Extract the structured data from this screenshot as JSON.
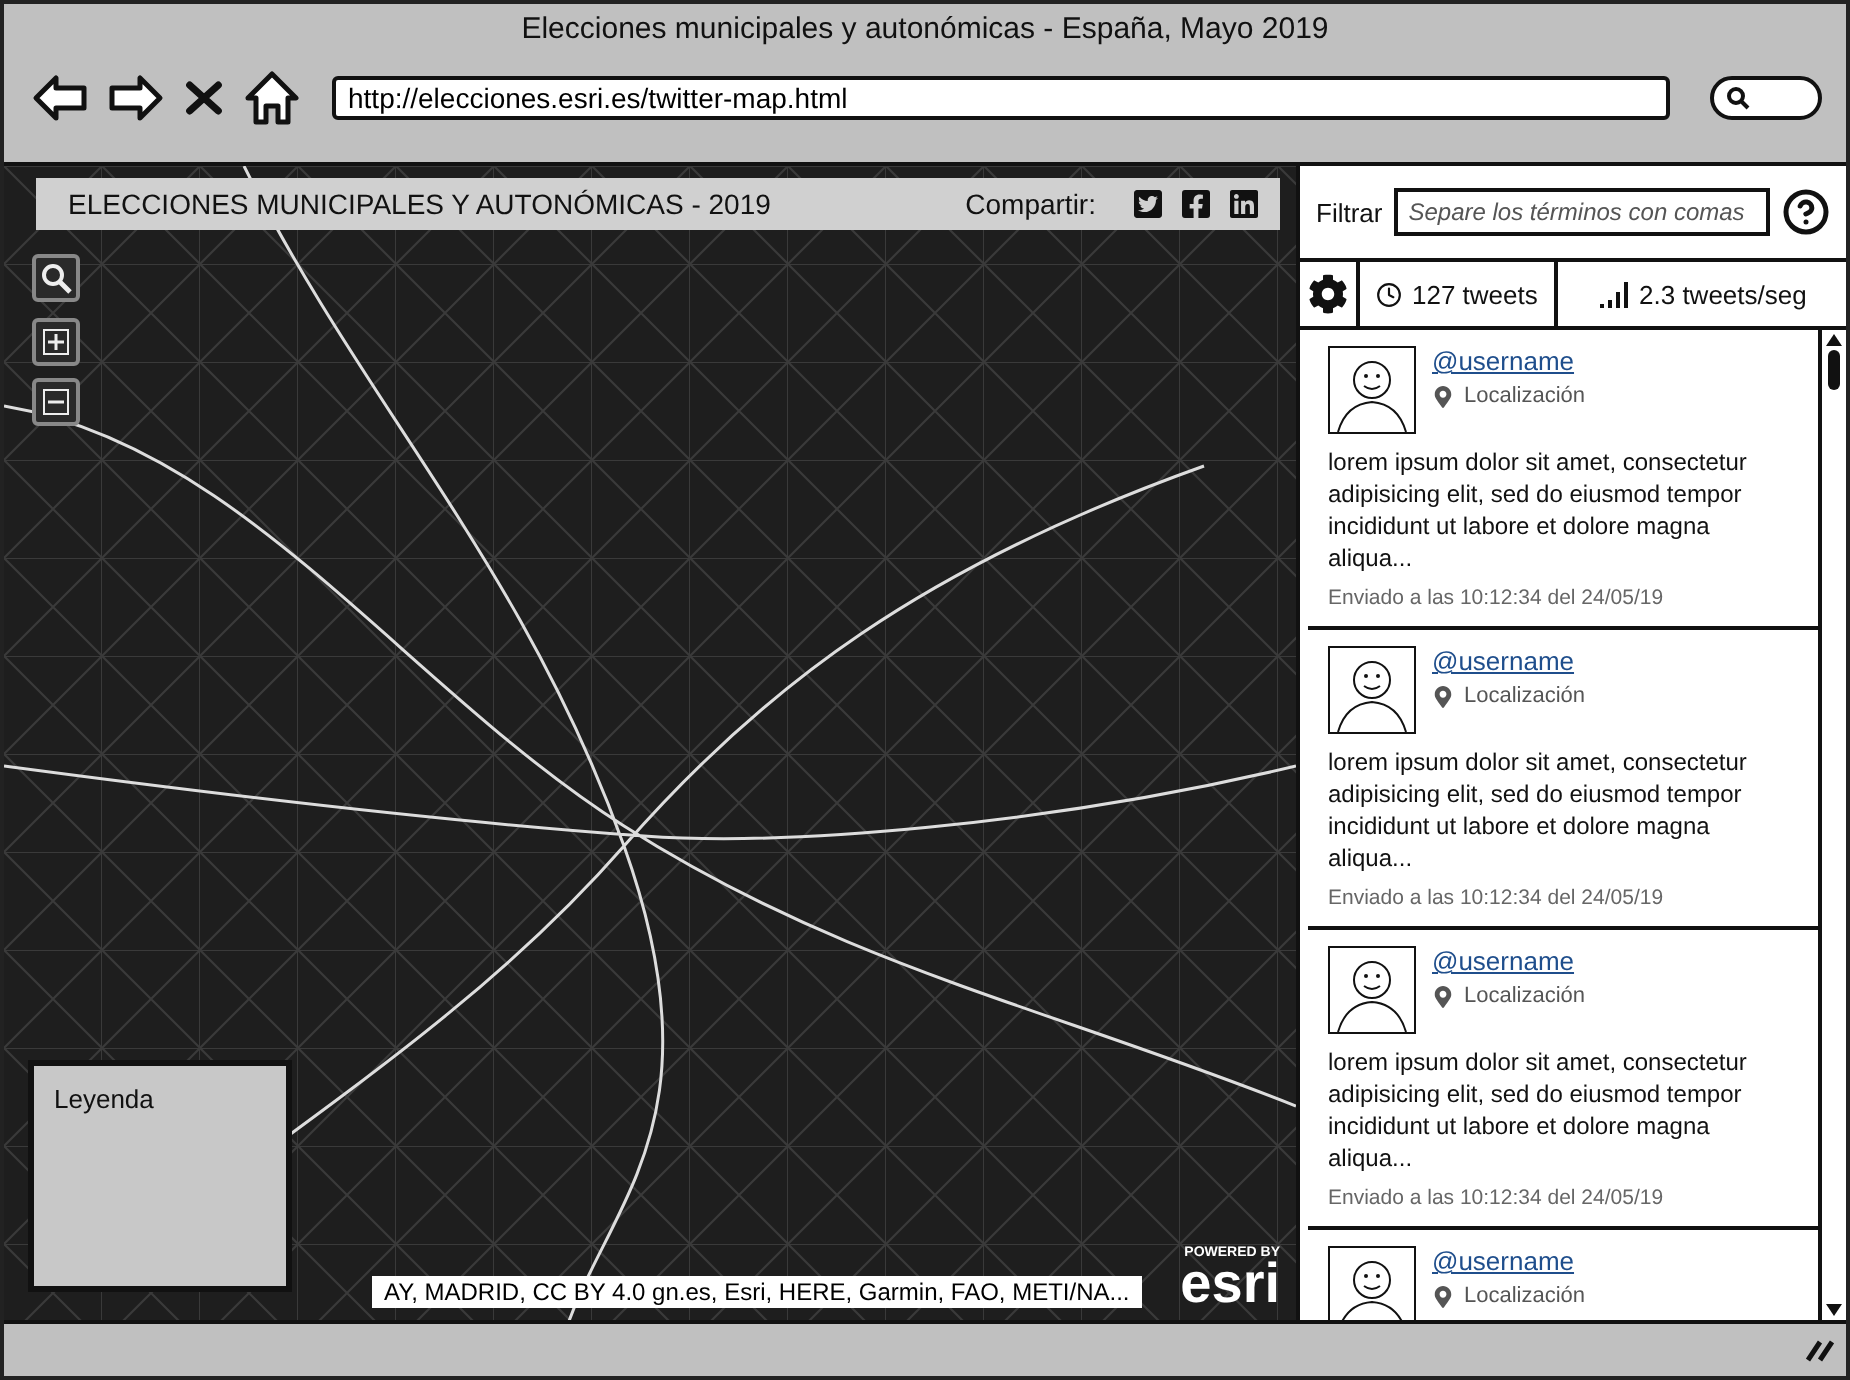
{
  "window": {
    "title": "Elecciones municipales y autonómicas - España, Mayo 2019"
  },
  "address_bar": {
    "value": "http://elecciones.esri.es/twitter-map.html"
  },
  "map": {
    "title": "ELECCIONES MUNICIPALES Y AUTONÓMICAS - 2019",
    "share_label": "Compartir:",
    "legend_title": "Leyenda",
    "attribution": "AY, MADRID, CC BY 4.0  gn.es, Esri, HERE, Garmin, FAO, METI/NA...",
    "logo": {
      "caption": "POWERED BY",
      "name": "esri"
    }
  },
  "sidebar": {
    "filter_label": "Filtrar",
    "filter_placeholder": "Separe los términos con comas",
    "tweet_count": "127 tweets",
    "rate": "2.3 tweets/seg",
    "tweets": [
      {
        "username": "@username",
        "location": "Localización",
        "text": "lorem ipsum dolor sit amet, consectetur adipisicing elit, sed do eiusmod tempor incididunt ut labore et dolore magna aliqua...",
        "sent": "Enviado a las 10:12:34 del 24/05/19"
      },
      {
        "username": "@username",
        "location": "Localización",
        "text": "lorem ipsum dolor sit amet, consectetur adipisicing elit, sed do eiusmod tempor incididunt ut labore et dolore magna aliqua...",
        "sent": "Enviado a las 10:12:34 del 24/05/19"
      },
      {
        "username": "@username",
        "location": "Localización",
        "text": "lorem ipsum dolor sit amet, consectetur adipisicing elit, sed do eiusmod tempor incididunt ut labore et dolore magna aliqua...",
        "sent": "Enviado a las 10:12:34 del 24/05/19"
      },
      {
        "username": "@username",
        "location": "Localización"
      }
    ]
  }
}
